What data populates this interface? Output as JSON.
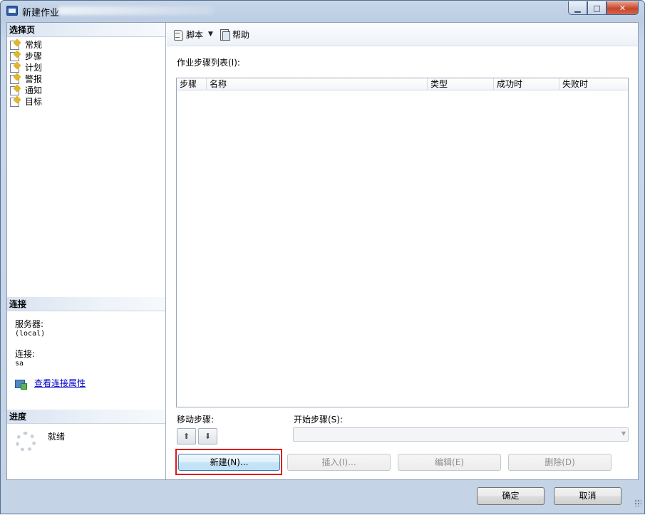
{
  "window": {
    "title": "新建作业",
    "minimize_glyph": "▁",
    "maximize_glyph": "□",
    "close_glyph": "✕"
  },
  "left_pane": {
    "select_page_header": "选择页",
    "pages": [
      {
        "label": "常规",
        "icon": "page-icon"
      },
      {
        "label": "步骤",
        "icon": "page-icon"
      },
      {
        "label": "计划",
        "icon": "page-icon"
      },
      {
        "label": "警报",
        "icon": "page-icon"
      },
      {
        "label": "通知",
        "icon": "page-icon"
      },
      {
        "label": "目标",
        "icon": "page-icon"
      }
    ],
    "connection_header": "连接",
    "server_label": "服务器:",
    "server_value": "(local)",
    "connection_label": "连接:",
    "connection_value": "sa",
    "view_properties_link": "查看连接属性",
    "progress_header": "进度",
    "progress_status": "就绪"
  },
  "toolbar": {
    "script_label": "脚本",
    "help_label": "帮助"
  },
  "main": {
    "steps_list_label": "作业步骤列表(I):",
    "columns": [
      "步骤",
      "名称",
      "类型",
      "成功时",
      "失败时"
    ],
    "rows": [],
    "move_step_label": "移动步骤:",
    "start_step_label": "开始步骤(S):",
    "start_step_value": "",
    "buttons": {
      "new": "新建(N)...",
      "insert": "插入(I)...",
      "edit": "编辑(E)",
      "delete": "删除(D)"
    },
    "highlight_color": "#e0191c"
  },
  "footer": {
    "ok": "确定",
    "cancel": "取消"
  }
}
